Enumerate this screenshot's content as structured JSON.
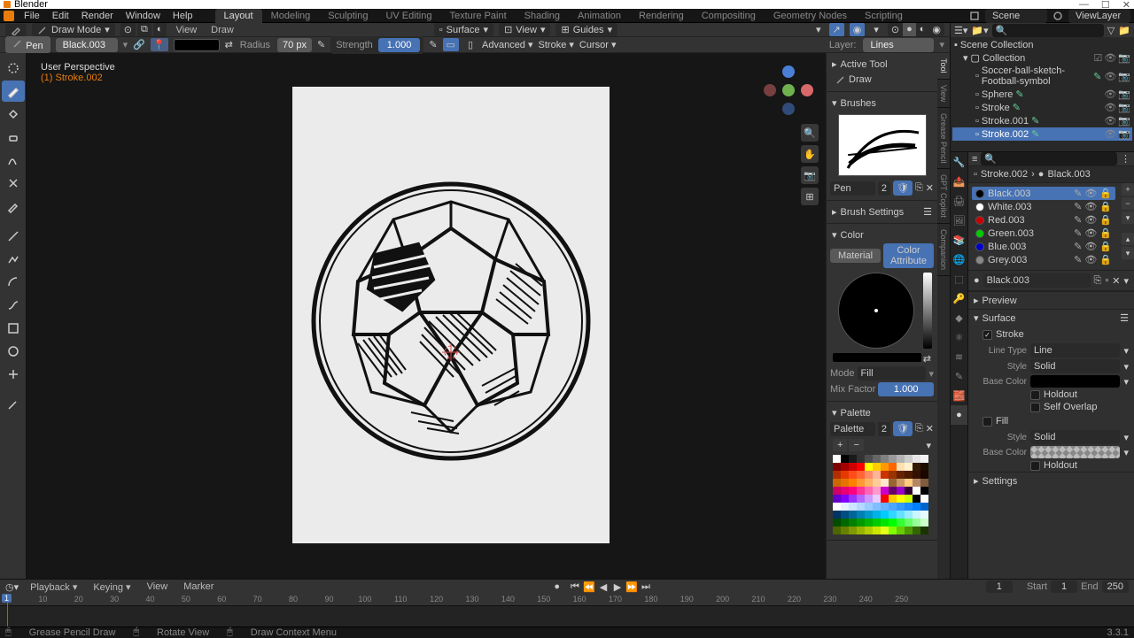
{
  "app": {
    "title": "Blender",
    "version": "3.3.1"
  },
  "menu": {
    "file": "File",
    "edit": "Edit",
    "render": "Render",
    "window": "Window",
    "help": "Help"
  },
  "workspaces": [
    "Layout",
    "Modeling",
    "Sculpting",
    "UV Editing",
    "Texture Paint",
    "Shading",
    "Animation",
    "Rendering",
    "Compositing",
    "Geometry Nodes",
    "Scripting"
  ],
  "workspace_active": 0,
  "scene_label": "Scene",
  "viewlayer_label": "ViewLayer",
  "view_header": {
    "mode": "Draw Mode",
    "menu_view": "View",
    "menu_draw": "Draw",
    "origin": "Surface",
    "plane": "View",
    "guides": "Guides"
  },
  "tool_header": {
    "brush_name": "Pen",
    "material": "Black.003",
    "radius_label": "Radius",
    "radius": "70 px",
    "strength_label": "Strength",
    "strength": "1.000",
    "advanced": "Advanced",
    "stroke": "Stroke",
    "cursor": "Cursor",
    "layer_label": "Layer:",
    "layer": "Lines"
  },
  "viewport_overlay": {
    "persp": "User Perspective",
    "object": "(1) Stroke.002"
  },
  "npanel": {
    "tabs": [
      "Tool",
      "View",
      "Grease Pencil",
      "GPT Copilot",
      "Companion"
    ],
    "active_tool": "Active Tool",
    "draw": "Draw",
    "brushes": "Brushes",
    "brush_name": "Pen",
    "brush_num": "2",
    "brush_settings": "Brush Settings",
    "color": "Color",
    "material": "Material",
    "color_attribute": "Color Attribute",
    "mode": "Mode",
    "mode_val": "Fill",
    "mix_factor": "Mix Factor",
    "mix_val": "1.000",
    "palette_header": "Palette",
    "palette_name": "Palette",
    "palette_num": "2"
  },
  "outliner": {
    "root": "Scene Collection",
    "coll": "Collection",
    "items": [
      {
        "name": "Soccer-ball-sketch-Football-symbol"
      },
      {
        "name": "Sphere"
      },
      {
        "name": "Stroke"
      },
      {
        "name": "Stroke.001"
      },
      {
        "name": "Stroke.002",
        "selected": true
      }
    ]
  },
  "props": {
    "breadcrumb_obj": "Stroke.002",
    "breadcrumb_mat": "Black.003",
    "materials": [
      {
        "name": "Black.003",
        "color": "#000",
        "selected": true
      },
      {
        "name": "White.003",
        "color": "#fff"
      },
      {
        "name": "Red.003",
        "color": "#c00"
      },
      {
        "name": "Green.003",
        "color": "#0c0"
      },
      {
        "name": "Blue.003",
        "color": "#00c"
      },
      {
        "name": "Grey.003",
        "color": "#888"
      }
    ],
    "matname": "Black.003",
    "preview": "Preview",
    "surface": "Surface",
    "stroke": "Stroke",
    "linetype_label": "Line Type",
    "linetype": "Line",
    "style_label": "Style",
    "style": "Solid",
    "basecolor_label": "Base Color",
    "holdout": "Holdout",
    "selfoverlap": "Self Overlap",
    "fill": "Fill",
    "fill_style": "Solid",
    "settings": "Settings"
  },
  "timeline": {
    "menu_playback": "Playback",
    "menu_keying": "Keying",
    "menu_view": "View",
    "menu_marker": "Marker",
    "current": "1",
    "start_label": "Start",
    "start": "1",
    "end_label": "End",
    "end": "250",
    "ticks": [
      0,
      10,
      20,
      30,
      40,
      50,
      60,
      70,
      80,
      90,
      100,
      110,
      120,
      130,
      140,
      150,
      160,
      170,
      180,
      190,
      200,
      210,
      220,
      230,
      240,
      250
    ]
  },
  "status": {
    "action1": "Grease Pencil Draw",
    "action2": "Rotate View",
    "action3": "Draw Context Menu"
  },
  "palette_colors": [
    "#ffffff",
    "#000000",
    "#1a1a1a",
    "#333333",
    "#4d4d4d",
    "#666666",
    "#808080",
    "#999999",
    "#b3b3b3",
    "#cccccc",
    "#e6e6e6",
    "#f2f2f2",
    "#7f0000",
    "#a50000",
    "#cc0000",
    "#ff0000",
    "#ffff00",
    "#ffcc00",
    "#ff9900",
    "#ff6600",
    "#ffe0b3",
    "#fff2cc",
    "#331a00",
    "#1a0d00",
    "#b32d00",
    "#e63900",
    "#ff4d1a",
    "#ff6633",
    "#ff8c66",
    "#ffb399",
    "#cc3300",
    "#993300",
    "#662200",
    "#4d1a00",
    "#331100",
    "#1a0800",
    "#cc6600",
    "#e67300",
    "#ff8000",
    "#ff9933",
    "#ffb366",
    "#ffcc99",
    "#ffe6cc",
    "#996633",
    "#cc9966",
    "#ffcc80",
    "#b38666",
    "#805c40",
    "#cc0066",
    "#e60073",
    "#ff0080",
    "#ff3399",
    "#ff66b3",
    "#ff99cc",
    "#cc00cc",
    "#660066",
    "#9900cc",
    "#330033",
    "#ffffff",
    "#000000",
    "#6600cc",
    "#8000ff",
    "#9933ff",
    "#b366ff",
    "#cc99ff",
    "#e6ccff",
    "#ff0000",
    "#ffcc00",
    "#ffff00",
    "#ccff00",
    "#000000",
    "#ffffff",
    "#ffffff",
    "#e6f2ff",
    "#cce6ff",
    "#b3d9ff",
    "#99ccff",
    "#80bfff",
    "#66b3ff",
    "#4da6ff",
    "#3399ff",
    "#1a8cff",
    "#0080ff",
    "#0066cc",
    "#003366",
    "#004d80",
    "#006699",
    "#0080b3",
    "#0099cc",
    "#00b3e6",
    "#00ccff",
    "#33d6ff",
    "#66e0ff",
    "#99ebff",
    "#ccf5ff",
    "#e6faff",
    "#004d00",
    "#006600",
    "#008000",
    "#009900",
    "#00b300",
    "#00cc00",
    "#00e600",
    "#00ff00",
    "#33ff33",
    "#66ff66",
    "#99ff99",
    "#ccffcc",
    "#4d6600",
    "#668000",
    "#809900",
    "#99b300",
    "#b3cc00",
    "#cce600",
    "#e6ff1a",
    "#80ff00",
    "#66cc00",
    "#4d9900",
    "#336600",
    "#1a3300"
  ]
}
